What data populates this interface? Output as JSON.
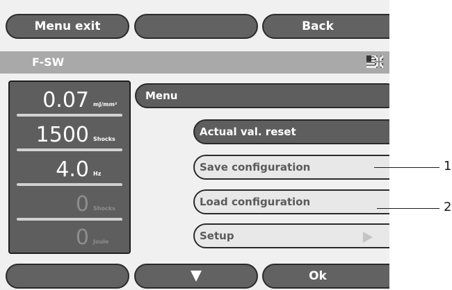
{
  "top_buttons": {
    "menu_exit": "Menu exit",
    "middle": "",
    "back": "Back"
  },
  "header": {
    "title": "F-SW",
    "flag_icon": "uk-us-flag-icon"
  },
  "values": [
    {
      "value": "0.07",
      "unit": "mJ/mm²"
    },
    {
      "value": "1500",
      "unit": "Shocks"
    },
    {
      "value": "4.0",
      "unit": "Hz"
    },
    {
      "value": "0",
      "unit": "Shocks"
    },
    {
      "value": "0",
      "unit": "Joule"
    }
  ],
  "menu": {
    "label": "Menu",
    "items": [
      {
        "label": "Actual val. reset"
      },
      {
        "label": "Save configuration"
      },
      {
        "label": "Load configuration"
      },
      {
        "label": "Setup"
      }
    ]
  },
  "bottom_buttons": {
    "left": "",
    "down_icon": "down-arrow-icon",
    "ok": "Ok"
  },
  "callouts": {
    "one": "1",
    "two": "2"
  }
}
